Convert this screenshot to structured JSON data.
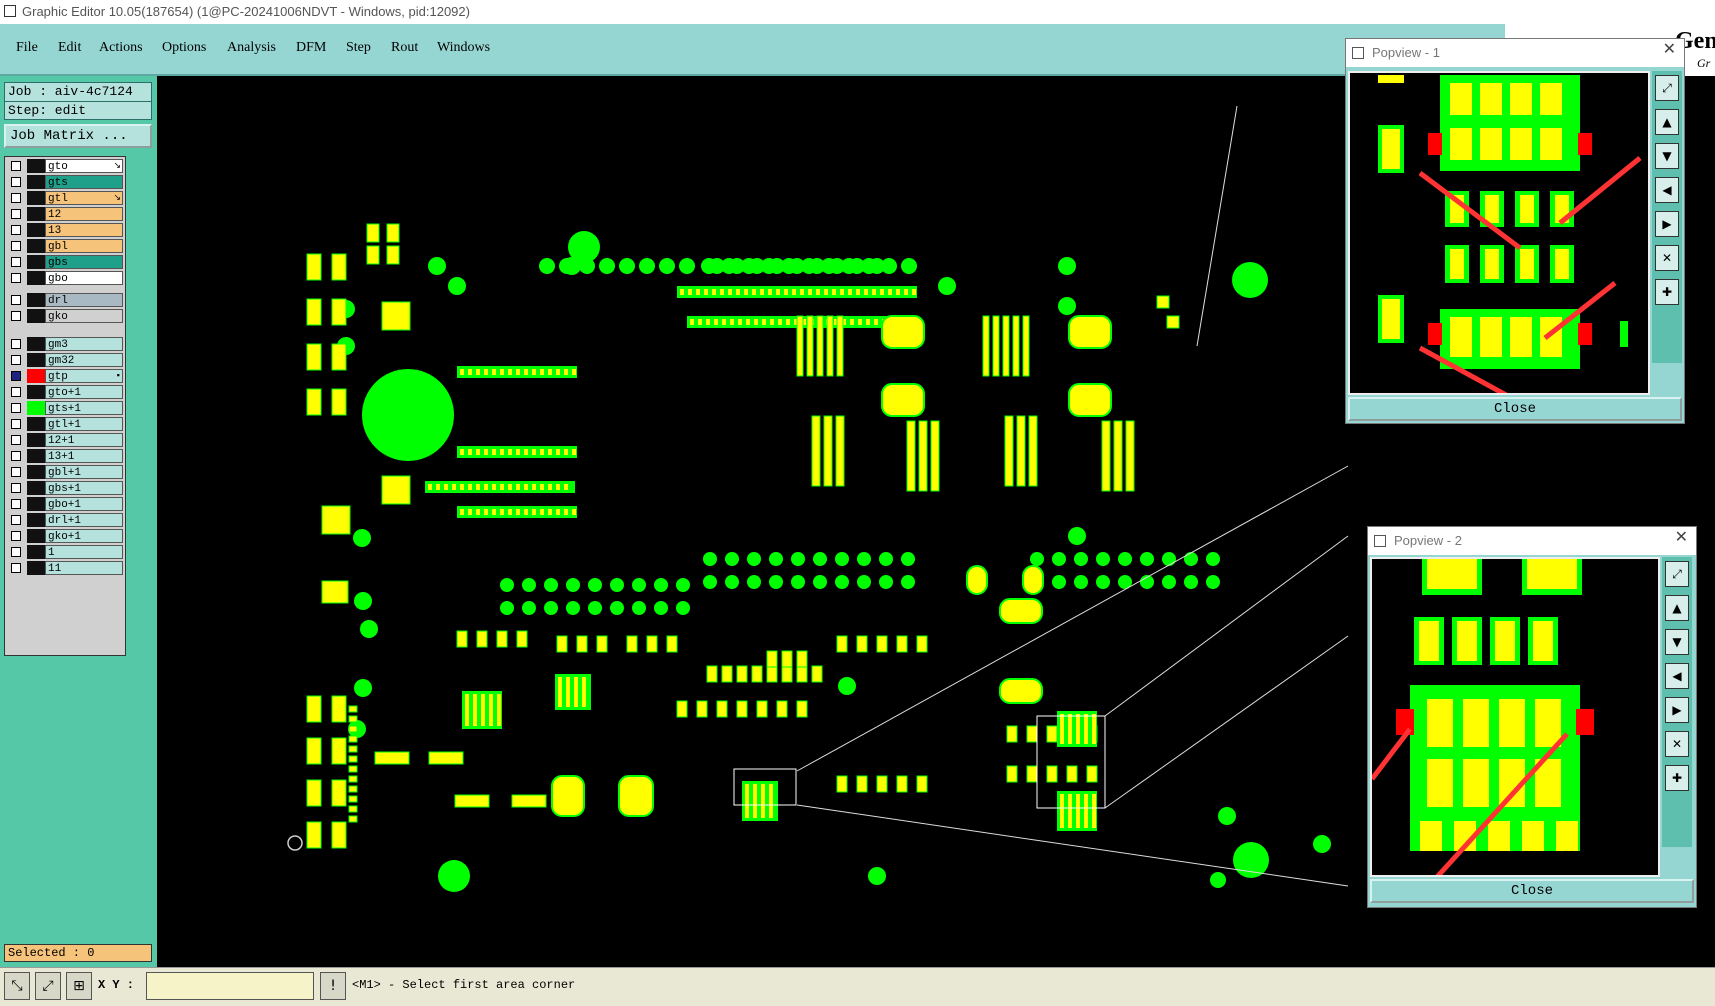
{
  "window": {
    "title": "Graphic Editor 10.05(187654) (1@PC-20241006NDVT - Windows, pid:12092)"
  },
  "menu": [
    "File",
    "Edit",
    "Actions",
    "Options",
    "Analysis",
    "DFM",
    "Step",
    "Rout",
    "Windows"
  ],
  "brand": {
    "big": "Gen",
    "small": "Gr"
  },
  "job": {
    "job_label": "Job : aiv-4c7124",
    "step_label": "Step: edit",
    "matrix_button": "Job Matrix ..."
  },
  "layers": [
    {
      "name": "gto",
      "bg": "#ffffff",
      "marker": "↘"
    },
    {
      "name": "gts",
      "bg": "#1ea08a",
      "marker": ""
    },
    {
      "name": "gtl",
      "bg": "#f6c37a",
      "marker": "↘"
    },
    {
      "name": "12",
      "bg": "#f6c37a",
      "marker": ""
    },
    {
      "name": "13",
      "bg": "#f6c37a",
      "marker": ""
    },
    {
      "name": "gbl",
      "bg": "#f6c37a",
      "marker": ""
    },
    {
      "name": "gbs",
      "bg": "#1ea08a",
      "marker": ""
    },
    {
      "name": "gbo",
      "bg": "#ffffff",
      "marker": ""
    },
    {
      "name": "drl",
      "bg": "#a9b9c4",
      "marker": ""
    },
    {
      "name": "gko",
      "bg": "#d0d0d0",
      "marker": ""
    },
    {
      "name": "gm3",
      "bg": "#b6e2de",
      "marker": ""
    },
    {
      "name": "gm32",
      "bg": "#b6e2de",
      "marker": ""
    },
    {
      "name": "gtp",
      "bg": "#b6e2de",
      "marker": "▪"
    },
    {
      "name": "gto+1",
      "bg": "#b6e2de",
      "marker": ""
    },
    {
      "name": "gts+1",
      "bg": "#b6e2de",
      "marker": ""
    },
    {
      "name": "gtl+1",
      "bg": "#b6e2de",
      "marker": ""
    },
    {
      "name": "12+1",
      "bg": "#b6e2de",
      "marker": ""
    },
    {
      "name": "13+1",
      "bg": "#b6e2de",
      "marker": ""
    },
    {
      "name": "gbl+1",
      "bg": "#b6e2de",
      "marker": ""
    },
    {
      "name": "gbs+1",
      "bg": "#b6e2de",
      "marker": ""
    },
    {
      "name": "gbo+1",
      "bg": "#b6e2de",
      "marker": ""
    },
    {
      "name": "drl+1",
      "bg": "#b6e2de",
      "marker": ""
    },
    {
      "name": "gko+1",
      "bg": "#b6e2de",
      "marker": ""
    },
    {
      "name": "1",
      "bg": "#b6e2de",
      "marker": ""
    },
    {
      "name": "11",
      "bg": "#b6e2de",
      "marker": ""
    }
  ],
  "selected_label": "Selected : 0",
  "status": {
    "xy_label": "X Y :",
    "xy_value": "",
    "prompt": "<M1> - Select first area corner"
  },
  "popview1": {
    "title": "Popview - 1",
    "close_label": "Close"
  },
  "popview2": {
    "title": "Popview - 2",
    "close_label": "Close"
  },
  "colors": {
    "pad": "#ffff00",
    "mask": "#00ff00",
    "highlight": "#ff0000",
    "arrow": "#ff3333",
    "panel": "#96d6d2"
  }
}
